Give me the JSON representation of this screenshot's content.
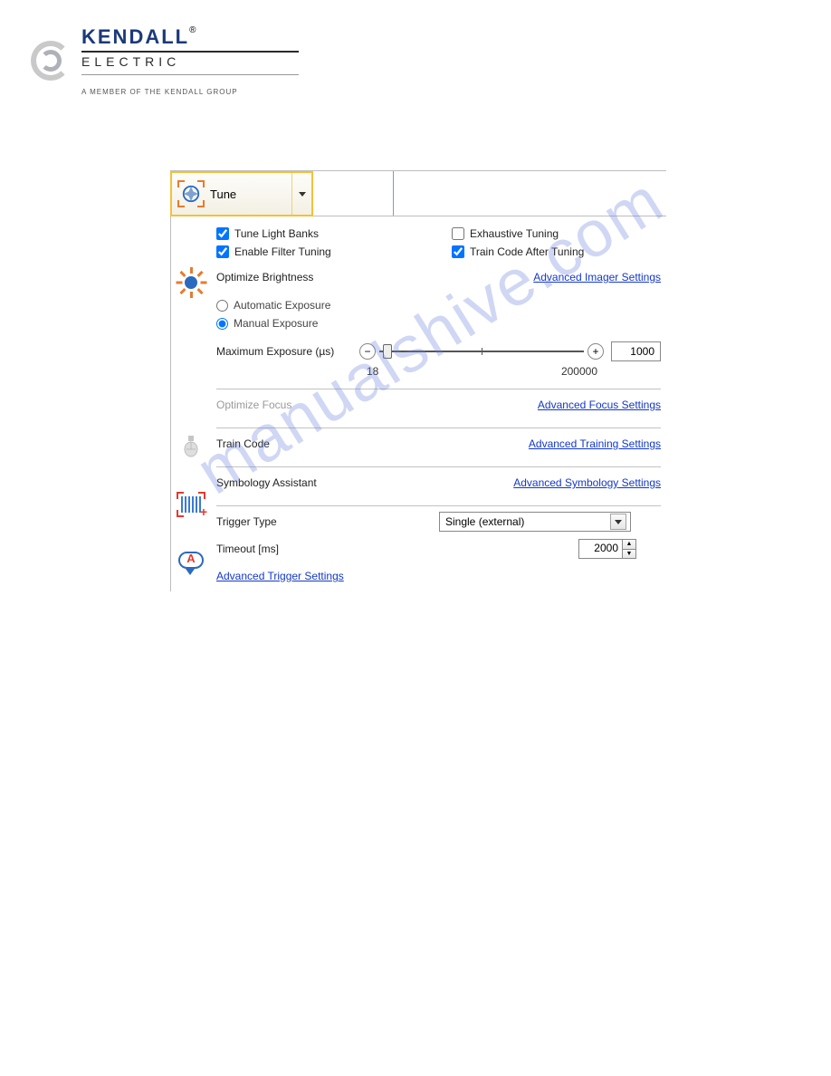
{
  "logo": {
    "name": "KENDALL",
    "reg": "®",
    "sub": "ELECTRIC",
    "member": "A MEMBER OF THE KENDALL GROUP"
  },
  "toolbar": {
    "tune_label": "Tune"
  },
  "checkboxes": {
    "tune_light_banks": {
      "label": "Tune Light Banks",
      "checked": true
    },
    "exhaustive_tuning": {
      "label": "Exhaustive Tuning",
      "checked": false
    },
    "enable_filter_tuning": {
      "label": "Enable Filter Tuning",
      "checked": true
    },
    "train_code_after_tuning": {
      "label": "Train Code After Tuning",
      "checked": true
    }
  },
  "brightness": {
    "title": "Optimize  Brightness",
    "link": "Advanced Imager  Settings",
    "radio_auto": "Automatic Exposure",
    "radio_manual": "Manual Exposure",
    "radio_selected": "manual",
    "slider_label": "Maximum Exposure (µs)",
    "min_label": "18",
    "max_label": "200000",
    "value": "1000"
  },
  "focus": {
    "title": "Optimize  Focus",
    "link": "Advanced Focus Settings"
  },
  "train": {
    "title": "Train Code",
    "link": "Advanced Training  Settings"
  },
  "symbology": {
    "title": "Symbology  Assistant",
    "link": "Advanced Symbology  Settings"
  },
  "trigger": {
    "type_label": "Trigger Type",
    "type_value": "Single (external)",
    "timeout_label": "Timeout [ms]",
    "timeout_value": "2000",
    "advanced_link": "Advanced Trigger Settings"
  },
  "watermark": "manualshive.com"
}
